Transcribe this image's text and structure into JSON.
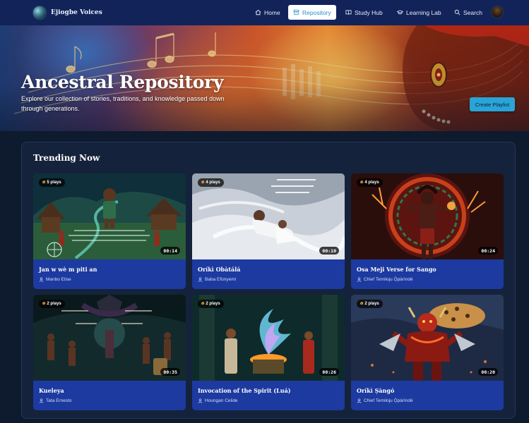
{
  "nav": {
    "brand": "Ejiogbe Voices",
    "items": [
      {
        "label": "Home",
        "icon": "home-icon"
      },
      {
        "label": "Repository",
        "icon": "archive-icon",
        "active": true
      },
      {
        "label": "Study Hub",
        "icon": "book-icon"
      },
      {
        "label": "Learning Lab",
        "icon": "graduation-cap-icon"
      },
      {
        "label": "Search",
        "icon": "search-icon"
      }
    ]
  },
  "hero": {
    "title": "Ancestral Repository",
    "subtitle": "Explore our collection of stories, traditions, and knowledge passed down through generations.",
    "create_button": "Create Playlist"
  },
  "trending": {
    "title": "Trending Now",
    "cards": [
      {
        "plays": "5 plays",
        "duration": "00:14",
        "title": "Jan w wè m piti an",
        "author": "Manbo Elise"
      },
      {
        "plays": "4 plays",
        "duration": "00:10",
        "title": "Oríkì Obàtálá",
        "author": "Baba Efúnyemi"
      },
      {
        "plays": "4 plays",
        "duration": "00:24",
        "title": "Osa Meji Verse for Sango",
        "author": "Chief Temiloju Ọ̀pàrìndé"
      },
      {
        "plays": "2 plays",
        "duration": "00:35",
        "title": "Kueleya",
        "author": "Tata Ernesto"
      },
      {
        "plays": "2 plays",
        "duration": "00:26",
        "title": "Invocation of the Spirit (Luá)",
        "author": "Houngan Celide"
      },
      {
        "plays": "2 plays",
        "duration": "00:20",
        "title": "Oríkì Ṣàngó",
        "author": "Chief Temiloju Ọ̀pàrìndé"
      }
    ]
  },
  "colors": {
    "nav_bg": "#12235a",
    "accent": "#2aa4d6",
    "card_bg": "#1c3aa0",
    "page_bg": "#0e1a2e"
  }
}
